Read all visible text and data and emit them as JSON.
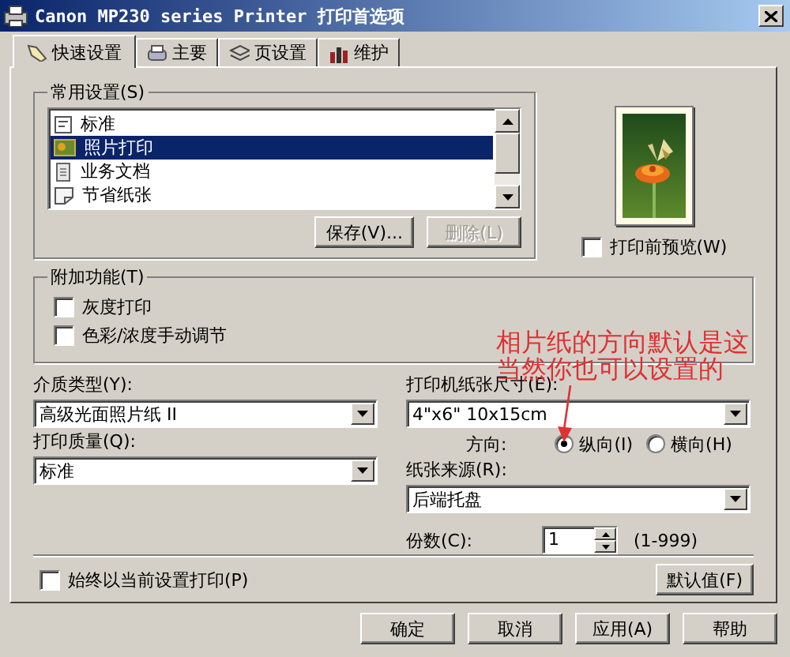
{
  "window": {
    "title": "Canon MP230 series Printer 打印首选项"
  },
  "tabs": [
    {
      "label": "快速设置",
      "selected": true
    },
    {
      "label": "主要",
      "selected": false
    },
    {
      "label": "页设置",
      "selected": false
    },
    {
      "label": "维护",
      "selected": false
    }
  ],
  "presets": {
    "label": "常用设置(S)",
    "items": [
      {
        "label": "标准",
        "selected": false
      },
      {
        "label": "照片打印",
        "selected": true
      },
      {
        "label": "业务文档",
        "selected": false
      },
      {
        "label": "节省纸张",
        "selected": false
      }
    ],
    "buttons": [
      {
        "label": "保存(V)...",
        "disabled": false
      },
      {
        "label": "删除(L)",
        "disabled": true
      }
    ]
  },
  "preview": {
    "kind": "picture",
    "checkbox": {
      "label": "打印前预览(W)",
      "checked": false
    }
  },
  "additional": {
    "label": "附加功能(T)",
    "options": [
      {
        "label": "灰度打印",
        "checked": false
      },
      {
        "label": "色彩/浓度手动调节",
        "checked": false
      }
    ]
  },
  "media_type": {
    "label": "介质类型(Y):",
    "value": "高级光面照片纸 II"
  },
  "paper_size": {
    "label": "打印机纸张尺寸(E):",
    "value": "4\"x6\" 10x15cm"
  },
  "orientation": {
    "label": "方向:",
    "options": [
      {
        "label": "纵向(I)",
        "selected": true
      },
      {
        "label": "横向(H)",
        "selected": false
      }
    ]
  },
  "print_quality": {
    "label": "打印质量(Q):",
    "value": "标准"
  },
  "paper_source": {
    "label": "纸张来源(R):",
    "value": "后端托盘"
  },
  "copies": {
    "label": "份数(C):",
    "value": "1",
    "range": "(1-999)"
  },
  "always_print": {
    "label": "始终以当前设置打印(P)",
    "checked": false
  },
  "defaults_button": "默认值(F)",
  "annotation": {
    "lines": [
      "相片纸的方向默认是这",
      "当然你也可以设置的"
    ]
  },
  "buttons": [
    "确定",
    "取消",
    "应用(A)",
    "帮助"
  ]
}
